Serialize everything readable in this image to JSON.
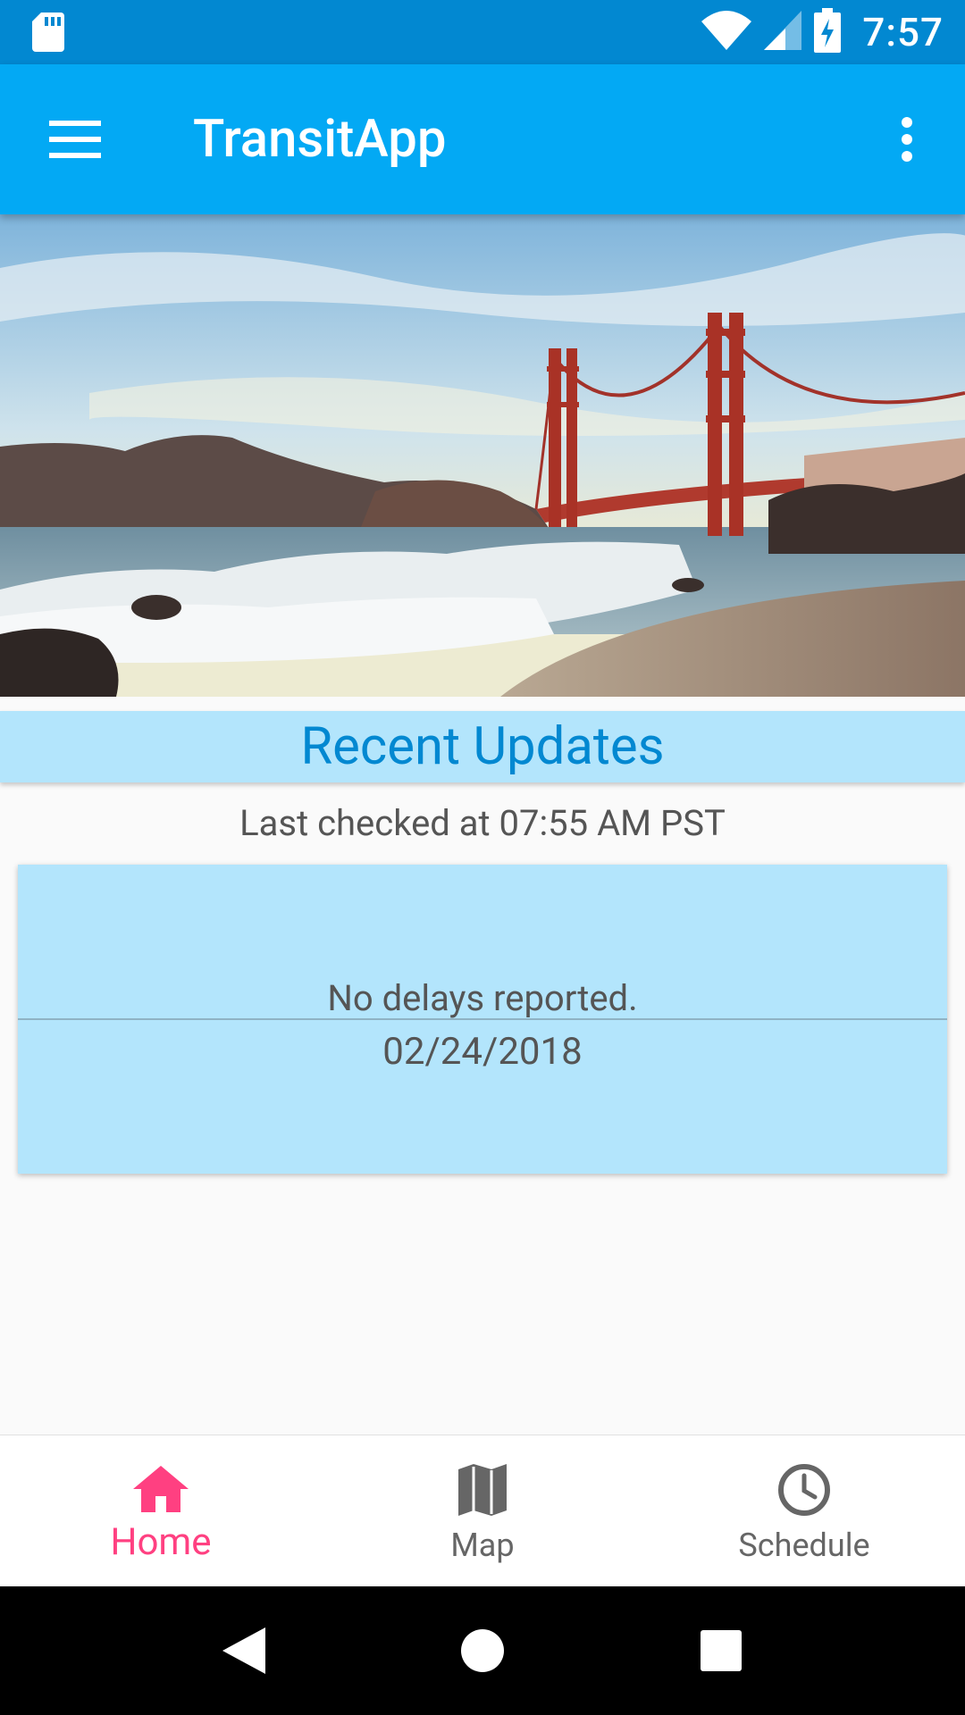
{
  "status_bar": {
    "time": "7:57",
    "icons": [
      "sd-card-icon",
      "wifi-icon",
      "cell-signal-icon",
      "battery-charging-icon"
    ]
  },
  "app_bar": {
    "title": "TransitApp",
    "icons": [
      "menu-icon",
      "more-vert-icon"
    ]
  },
  "hero": {
    "icon": "golden-gate-bridge-image"
  },
  "updates": {
    "section_title": "Recent Updates",
    "last_checked": "Last checked at 07:55 AM PST",
    "items": [
      {
        "message": "No delays reported.",
        "date": "02/24/2018"
      }
    ]
  },
  "bottom_nav": {
    "items": [
      {
        "label": "Home",
        "icon": "home-icon",
        "active": true
      },
      {
        "label": "Map",
        "icon": "map-icon",
        "active": false
      },
      {
        "label": "Schedule",
        "icon": "clock-icon",
        "active": false
      }
    ]
  },
  "system_nav": {
    "icons": [
      "back-icon",
      "home-circle-icon",
      "recents-icon"
    ]
  },
  "colors": {
    "status_bar": "#0288D1",
    "app_bar": "#03A9F4",
    "section_bg": "#B3E5FC",
    "section_title": "#0288D1",
    "accent": "#FF4081"
  }
}
